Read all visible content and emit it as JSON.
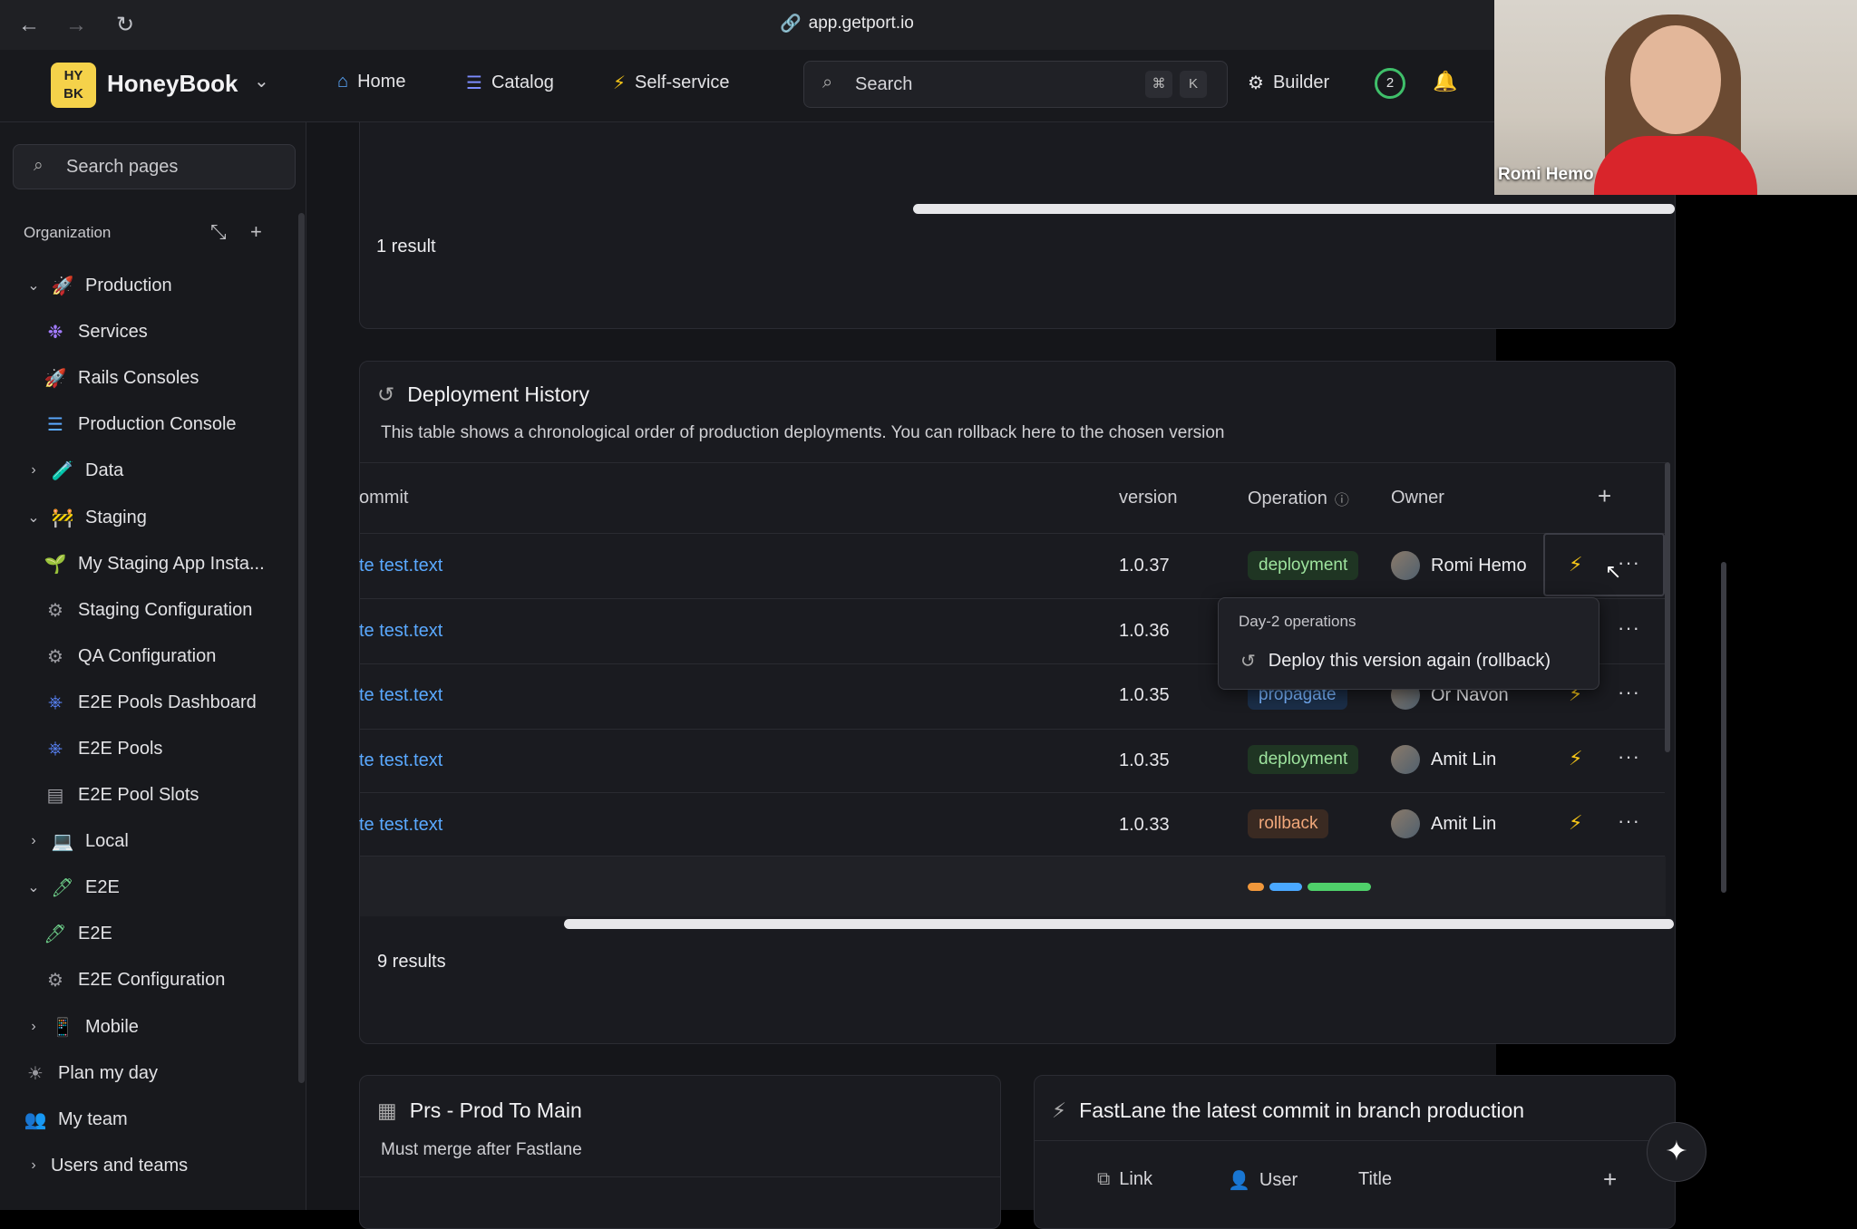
{
  "browser": {
    "url": "app.getport.io"
  },
  "app": {
    "logo_text": "HY BK",
    "brand": "HoneyBook",
    "nav": [
      {
        "label": "Home",
        "icon": "home-icon"
      },
      {
        "label": "Catalog",
        "icon": "catalog-icon"
      },
      {
        "label": "Self-service",
        "icon": "bolt-icon"
      }
    ],
    "search": {
      "label": "Search",
      "kbd1": "⌘",
      "kbd2": "K"
    },
    "builder": "Builder",
    "notification_count": "2"
  },
  "sidebar": {
    "search_placeholder": "Search pages",
    "section": "Organization",
    "items": [
      {
        "label": "Production",
        "chev": "⌄",
        "icon": "🚀"
      },
      {
        "label": "Services",
        "icon": "❉"
      },
      {
        "label": "Rails Consoles",
        "icon": "🚀"
      },
      {
        "label": "Production Console",
        "icon": "☰"
      },
      {
        "label": "Data",
        "chev": "›",
        "icon": "🧪"
      },
      {
        "label": "Staging",
        "chev": "⌄",
        "icon": "🚧"
      },
      {
        "label": "My Staging App Insta...",
        "icon": "🌱"
      },
      {
        "label": "Staging Configuration",
        "icon": "⚙"
      },
      {
        "label": "QA Configuration",
        "icon": "⚙"
      },
      {
        "label": "E2E Pools Dashboard",
        "icon": "⎈"
      },
      {
        "label": "E2E Pools",
        "icon": "⎈"
      },
      {
        "label": "E2E Pool Slots",
        "icon": "▤"
      },
      {
        "label": "Local",
        "chev": "›",
        "icon": "💻"
      },
      {
        "label": "E2E",
        "chev": "⌄",
        "icon": "🖊"
      },
      {
        "label": "E2E",
        "icon": "🖊"
      },
      {
        "label": "E2E Configuration",
        "icon": "⚙"
      },
      {
        "label": "Mobile",
        "chev": "›",
        "icon": "📱"
      },
      {
        "label": "Plan my day",
        "icon": "☀"
      },
      {
        "label": "My team",
        "icon": "👥"
      },
      {
        "label": "Users and teams",
        "chev": "›",
        "icon": ""
      }
    ]
  },
  "top_card": {
    "results": "1 result"
  },
  "deployment_history": {
    "title": "Deployment History",
    "description": "This table shows a chronological order of production deployments. You can rollback here to the chosen version",
    "columns": [
      "ommit",
      "version",
      "Operation",
      "Owner"
    ],
    "rows": [
      {
        "commit": "te test.text",
        "version": "1.0.37",
        "operation": "deployment",
        "owner": "Romi Hemo"
      },
      {
        "commit": "te test.text",
        "version": "1.0.36",
        "operation": "",
        "owner": ""
      },
      {
        "commit": "te test.text",
        "version": "1.0.35",
        "operation": "propagate",
        "owner": "Or Navon"
      },
      {
        "commit": "te test.text",
        "version": "1.0.35",
        "operation": "deployment",
        "owner": "Amit Lin"
      },
      {
        "commit": "te test.text",
        "version": "1.0.33",
        "operation": "rollback",
        "owner": "Amit Lin"
      }
    ],
    "results": "9 results",
    "popup": {
      "header": "Day-2 operations",
      "item": "Deploy this version again (rollback)"
    }
  },
  "prs_card": {
    "title": "Prs - Prod To Main",
    "subtitle": "Must merge after Fastlane"
  },
  "fastlane_card": {
    "title": "FastLane the latest commit in branch production",
    "columns": [
      "Link",
      "User",
      "Title"
    ]
  },
  "video": {
    "name": "Romi Hemo"
  },
  "colors": {
    "accent_link": "#5aa9ff",
    "bolt": "#f5c518",
    "deployment": "#9ee39e",
    "propagate": "#78b4ff",
    "rollback": "#f0a77a"
  }
}
